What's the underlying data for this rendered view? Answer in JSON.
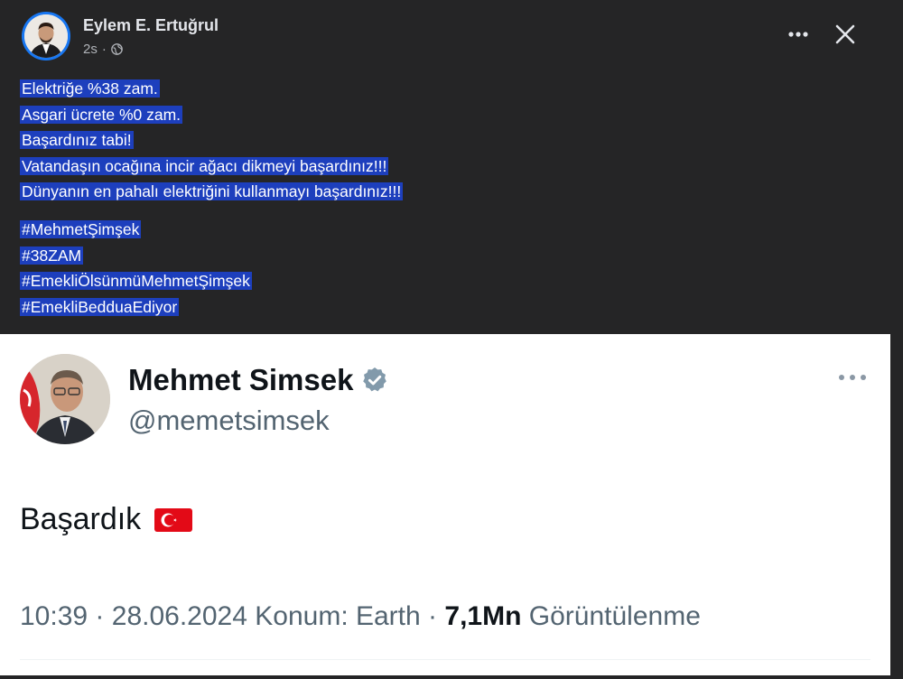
{
  "post": {
    "author_name": "Eylem E. Ertuğrul",
    "timestamp": "2s",
    "privacy_icon": "globe-icon",
    "lines": [
      "Elektriğe %38 zam.",
      "Asgari ücrete %0 zam.",
      "Başardınız tabi!",
      "Vatandaşın ocağına incir ağacı dikmeyi başardınız!!!",
      "Dünyanın en pahalı elektriğini kullanmayı başardınız!!!"
    ],
    "hashtags": [
      "#MehmetŞimşek",
      "#38ZAM",
      "#EmekliÖlsünmüMehmetŞimşek",
      "#EmekliBedduaEdiyor"
    ],
    "more_label": "•••"
  },
  "tweet": {
    "name": "Mehmet Simsek",
    "handle": "@memetsimsek",
    "text": "Başardık",
    "time": "10:39",
    "date": "28.06.2024",
    "location": "Konum: Earth",
    "views_count": "7,1Mn",
    "views_label": "Görüntülenme",
    "separator": "·"
  },
  "colors": {
    "facebook_bg": "#252526",
    "selection_highlight": "#1d3fbd",
    "tweet_bg": "#ffffff",
    "verified": "#829aab",
    "tweet_secondary_text": "#536471"
  }
}
